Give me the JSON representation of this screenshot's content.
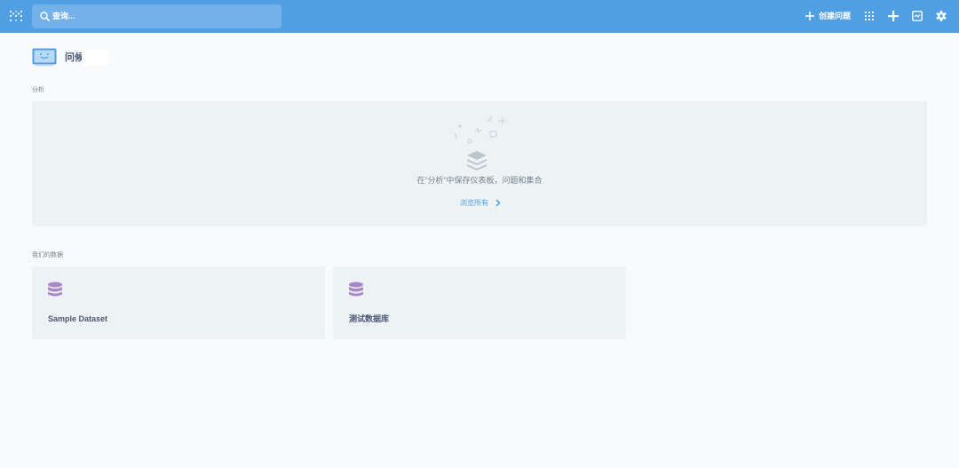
{
  "navbar": {
    "logo_icon": "metabase-logo-icon",
    "search": {
      "placeholder": "查询...",
      "icon": "search-icon"
    },
    "new_question": {
      "label": "创建问题",
      "icon": "plus-icon"
    },
    "actions": [
      {
        "name": "apps-grid-icon"
      },
      {
        "name": "add-icon"
      },
      {
        "name": "activity-icon"
      },
      {
        "name": "gear-icon"
      }
    ],
    "background_color": "#509ee3"
  },
  "greeting": {
    "text": "问候",
    "icon": "smiling-computer-icon"
  },
  "analytics": {
    "section_label": "分析",
    "empty_message": "在“分析”中保存仪表板，问题和集合",
    "browse_label": "浏览所有"
  },
  "databases": {
    "section_label": "我们的数据",
    "items": [
      {
        "name": "Sample Dataset",
        "icon": "database-icon"
      },
      {
        "name": "测试数据库",
        "icon": "database-icon"
      }
    ],
    "icon_color": "#a989c5"
  }
}
